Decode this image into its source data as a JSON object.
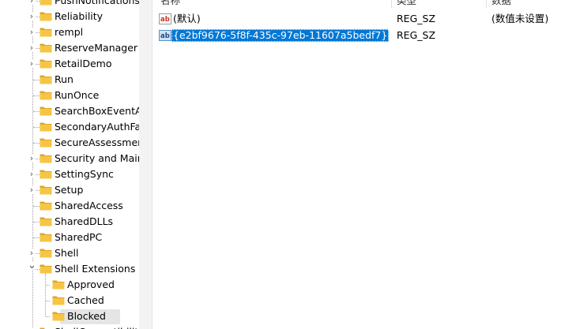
{
  "tree": {
    "items": [
      {
        "label": "PushNotifications",
        "expander": "collapsed",
        "depth": 0
      },
      {
        "label": "Reliability",
        "expander": "collapsed",
        "depth": 0
      },
      {
        "label": "rempl",
        "expander": "collapsed",
        "depth": 0
      },
      {
        "label": "ReserveManager",
        "expander": "collapsed",
        "depth": 0
      },
      {
        "label": "RetailDemo",
        "expander": "collapsed",
        "depth": 0
      },
      {
        "label": "Run",
        "expander": "none",
        "depth": 0
      },
      {
        "label": "RunOnce",
        "expander": "none",
        "depth": 0
      },
      {
        "label": "SearchBoxEventAr",
        "expander": "none",
        "depth": 0
      },
      {
        "label": "SecondaryAuthFac",
        "expander": "none",
        "depth": 0
      },
      {
        "label": "SecureAssessmen",
        "expander": "none",
        "depth": 0
      },
      {
        "label": "Security and Main",
        "expander": "collapsed",
        "depth": 0
      },
      {
        "label": "SettingSync",
        "expander": "collapsed",
        "depth": 0
      },
      {
        "label": "Setup",
        "expander": "collapsed",
        "depth": 0
      },
      {
        "label": "SharedAccess",
        "expander": "none",
        "depth": 0
      },
      {
        "label": "SharedDLLs",
        "expander": "none",
        "depth": 0
      },
      {
        "label": "SharedPC",
        "expander": "none",
        "depth": 0
      },
      {
        "label": "Shell",
        "expander": "collapsed",
        "depth": 0
      },
      {
        "label": "Shell Extensions",
        "expander": "expanded",
        "depth": 0
      },
      {
        "label": "Approved",
        "expander": "none",
        "depth": 1
      },
      {
        "label": "Cached",
        "expander": "none",
        "depth": 1
      },
      {
        "label": "Blocked",
        "expander": "none",
        "depth": 1,
        "selected": true
      },
      {
        "label": "ShellCompatibility",
        "expander": "collapsed",
        "depth": 0
      }
    ]
  },
  "list": {
    "headers": {
      "name": "名称",
      "type": "类型",
      "data": "数据"
    },
    "rows": [
      {
        "name": "(默认)",
        "type": "REG_SZ",
        "data": "(数值未设置)",
        "icon": "string-value-icon"
      },
      {
        "name": "{e2bf9676-5f8f-435c-97eb-11607a5bedf7}",
        "type": "REG_SZ",
        "data": "",
        "icon": "string-value-icon",
        "selected": true
      }
    ]
  },
  "colors": {
    "folder": "#f6c544",
    "folder_dark": "#e0a526",
    "selection": "#0078d7",
    "tree_selection": "#e5e5e5"
  }
}
